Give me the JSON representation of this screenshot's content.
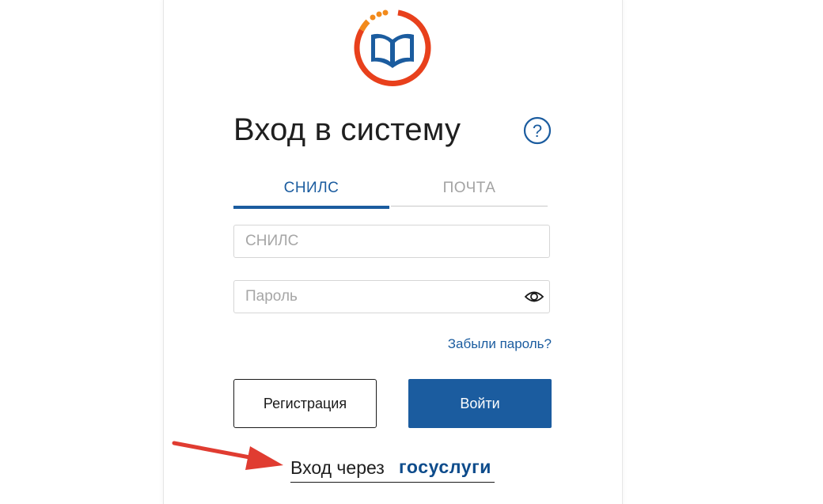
{
  "login": {
    "title": "Вход в систему",
    "help_glyph": "?",
    "tabs": [
      {
        "label": "СНИЛС",
        "active": true
      },
      {
        "label": "ПОЧТА",
        "active": false
      }
    ],
    "snils_placeholder": "СНИЛС",
    "password_placeholder": "Пароль",
    "forgot_link": "Забыли пароль?",
    "register_button": "Регистрация",
    "login_button": "Войти",
    "gosuslugi_prefix": "Вход через",
    "gosuslugi_brand": "госуслуги"
  },
  "icons": {
    "logo": "book-in-ring-logo",
    "help": "question-circle-icon",
    "password_toggle": "eye-icon",
    "annotation": "red-arrow-annotation"
  },
  "colors": {
    "primary": "#1b5c9f",
    "brand_dark": "#0d4b8b",
    "logo_ring": "#e8401c",
    "logo_ring_accent": "#f28a1b",
    "annotation_arrow": "#e03c31",
    "inactive_tab": "#a3a3a3",
    "text": "#1f1f1f"
  }
}
